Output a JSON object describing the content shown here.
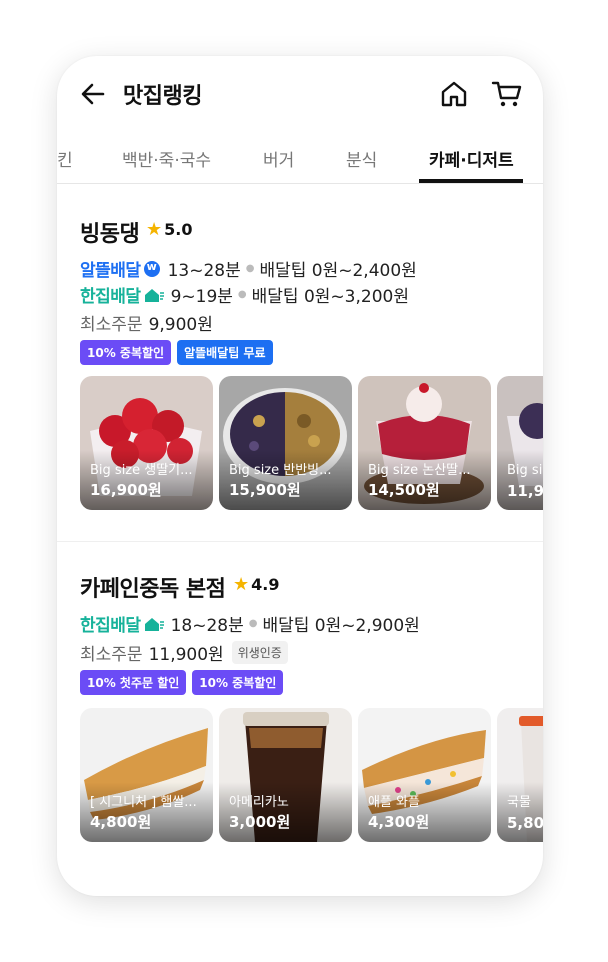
{
  "header": {
    "title": "맛집랭킹"
  },
  "tabs": [
    {
      "label": "킨"
    },
    {
      "label": "백반·죽·국수"
    },
    {
      "label": "버거"
    },
    {
      "label": "분식"
    },
    {
      "label": "카페·디저트"
    }
  ],
  "stores": [
    {
      "name": "빙동댕",
      "rating": "5.0",
      "delivery": [
        {
          "brand": "알뜰배달",
          "time": "13~28분",
          "tip": "배달팁 0원~2,400원"
        },
        {
          "brand": "한집배달",
          "time": "9~19분",
          "tip": "배달팁 0원~3,200원"
        }
      ],
      "min_order_label": "최소주문",
      "min_order_value": "9,900원",
      "chips": [
        "10% 중복할인",
        "알뜰배달팁 무료"
      ],
      "menu": [
        {
          "name": "Big size 생딸기...",
          "price": "16,900원"
        },
        {
          "name": "Big size 반반빙...",
          "price": "15,900원"
        },
        {
          "name": "Big size 논산딸...",
          "price": "14,500원"
        },
        {
          "name": "Big si",
          "price": "11,9"
        }
      ]
    },
    {
      "name": "카페인중독 본점",
      "rating": "4.9",
      "delivery": [
        {
          "brand": "한집배달",
          "time": "18~28분",
          "tip": "배달팁 0원~2,900원"
        }
      ],
      "min_order_label": "최소주문",
      "min_order_value": "11,900원",
      "hygiene": "위생인증",
      "chips": [
        "10% 첫주문 할인",
        "10% 중복할인"
      ],
      "menu": [
        {
          "name": "[ 시그니처 ] 햄쌀...",
          "price": "4,800원"
        },
        {
          "name": "아메리카노",
          "price": "3,000원"
        },
        {
          "name": "애플 와플",
          "price": "4,300원"
        },
        {
          "name": "국물",
          "price": "5,80"
        }
      ]
    }
  ],
  "colors": {
    "blue": "#1d6ff2",
    "teal": "#16b29a",
    "purple": "#6b4cf6",
    "star": "#f5b400"
  }
}
